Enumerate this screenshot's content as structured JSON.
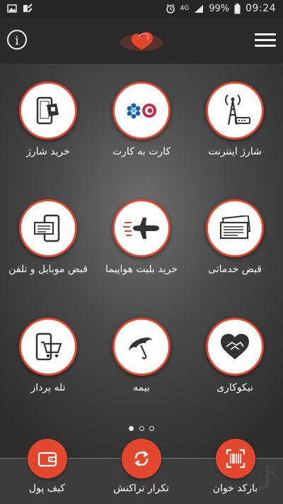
{
  "status_bar": {
    "time": "09:24",
    "battery": "99%",
    "network": "4G",
    "left_icons": [
      "image-icon",
      "app-notification-icon"
    ],
    "right_icons": [
      "alarm-icon",
      "signal-icon",
      "battery-icon"
    ]
  },
  "header": {
    "info_label": "i",
    "logo": "app-logo",
    "menu": "hamburger-menu-icon"
  },
  "tiles": [
    {
      "label": "خرید شارژ",
      "icon": "phone-sim-icon"
    },
    {
      "label": "کارت به کارت",
      "icon": "card-to-card-icon"
    },
    {
      "label": "شارژ اینترنت",
      "icon": "internet-tower-icon"
    },
    {
      "label": "قبض موبایل و تلفن",
      "icon": "phone-bill-icon"
    },
    {
      "label": "خرید بلیت هواپیما",
      "icon": "airplane-icon"
    },
    {
      "label": "قبض خدماتی",
      "icon": "utility-bill-icon"
    },
    {
      "label": "تله پرداز",
      "icon": "phone-cart-icon"
    },
    {
      "label": "بیمه",
      "icon": "umbrella-icon"
    },
    {
      "label": "نیکوکاری",
      "icon": "heart-hands-icon"
    }
  ],
  "pager": {
    "pages": 3,
    "active": 1
  },
  "bottom_bar": [
    {
      "label": "کیف پول",
      "icon": "wallet-icon"
    },
    {
      "label": "تکرار تراکنش",
      "icon": "repeat-icon"
    },
    {
      "label": "بارکد خوان",
      "icon": "barcode-icon"
    }
  ],
  "colors": {
    "accent": "#e3472e",
    "header_bg": "#2b2b2b",
    "bottom_bg": "#3d3d3d"
  }
}
